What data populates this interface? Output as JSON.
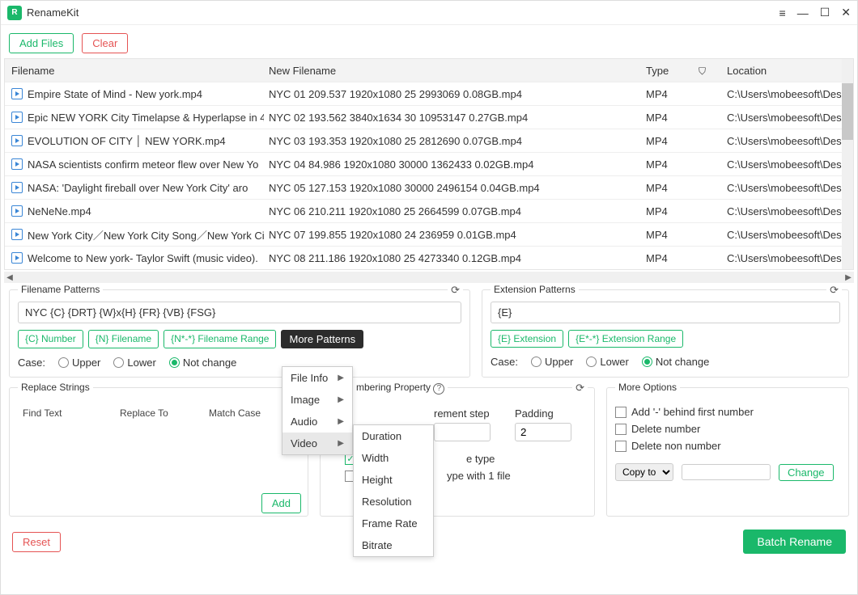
{
  "app": {
    "title": "RenameKit"
  },
  "buttons": {
    "add_files": "Add Files",
    "clear": "Clear",
    "add": "Add",
    "reset": "Reset",
    "batch_rename": "Batch Rename",
    "more_patterns": "More Patterns",
    "change": "Change"
  },
  "table": {
    "headers": {
      "filename": "Filename",
      "new_filename": "New Filename",
      "type": "Type",
      "location": "Location"
    },
    "rows": [
      {
        "filename": "Empire State of Mind - New york.mp4",
        "new_filename": "NYC 01 209.537 1920x1080 25 2993069 0.08GB.mp4",
        "type": "MP4",
        "location": "C:\\Users\\mobeesoft\\Deskt"
      },
      {
        "filename": "Epic NEW YORK City Timelapse & Hyperlapse in 4",
        "new_filename": "NYC 02 193.562 3840x1634 30 10953147 0.27GB.mp4",
        "type": "MP4",
        "location": "C:\\Users\\mobeesoft\\Deskt"
      },
      {
        "filename": "EVOLUTION OF CITY │ NEW YORK.mp4",
        "new_filename": "NYC 03 193.353 1920x1080 25 2812690 0.07GB.mp4",
        "type": "MP4",
        "location": "C:\\Users\\mobeesoft\\Deskt"
      },
      {
        "filename": "NASA scientists confirm meteor flew over New Yo",
        "new_filename": "NYC 04 84.986 1920x1080 30000 1362433 0.02GB.mp4",
        "type": "MP4",
        "location": "C:\\Users\\mobeesoft\\Deskt"
      },
      {
        "filename": "NASA:   'Daylight fireball over New York City' aro",
        "new_filename": "NYC 05 127.153 1920x1080 30000 2496154 0.04GB.mp4",
        "type": "MP4",
        "location": "C:\\Users\\mobeesoft\\Deskt"
      },
      {
        "filename": "NeNeNe.mp4",
        "new_filename": "NYC 06 210.211 1920x1080 25 2664599 0.07GB.mp4",
        "type": "MP4",
        "location": "C:\\Users\\mobeesoft\\Deskt"
      },
      {
        "filename": "New York City／New York City Song／New York Cit",
        "new_filename": "NYC 07 199.855 1920x1080 24 236959 0.01GB.mp4",
        "type": "MP4",
        "location": "C:\\Users\\mobeesoft\\Deskt"
      },
      {
        "filename": "Welcome to New york- Taylor Swift (music video).",
        "new_filename": "NYC 08 211.186 1920x1080 25 4273340 0.12GB.mp4",
        "type": "MP4",
        "location": "C:\\Users\\mobeesoft\\Deskt"
      }
    ]
  },
  "patterns": {
    "title": "Filename Patterns",
    "value": "NYC {C} {DRT} {W}x{H} {FR} {VB} {FSG}",
    "tags": {
      "number": "{C} Number",
      "filename": "{N} Filename",
      "range": "{N*-*} Filename Range"
    },
    "case_label": "Case:",
    "opts": {
      "upper": "Upper",
      "lower": "Lower",
      "not_change": "Not change"
    }
  },
  "ext_patterns": {
    "title": "Extension Patterns",
    "value": "{E}",
    "tags": {
      "extension": "{E} Extension",
      "range": "{E*-*} Extension Range"
    }
  },
  "replace": {
    "title": "Replace Strings",
    "cols": {
      "find": "Find Text",
      "replace": "Replace To",
      "match": "Match Case"
    }
  },
  "numbering": {
    "title_suffix": "mbering Property",
    "cols": {
      "step": "rement step",
      "padding": "Padding"
    },
    "padding_val": "2",
    "checks": {
      "type": "e type",
      "single": "ype with 1 file"
    }
  },
  "more_opts": {
    "title": "More Options",
    "checks": {
      "dash": "Add '-' behind first number",
      "del_num": "Delete number",
      "del_non": "Delete non number"
    },
    "copy_to": "Copy to"
  },
  "popup": {
    "items": {
      "file_info": "File Info",
      "image": "Image",
      "audio": "Audio",
      "video": "Video"
    }
  },
  "submenu": {
    "items": {
      "duration": "Duration",
      "width": "Width",
      "height": "Height",
      "resolution": "Resolution",
      "frame_rate": "Frame Rate",
      "bitrate": "Bitrate"
    }
  }
}
